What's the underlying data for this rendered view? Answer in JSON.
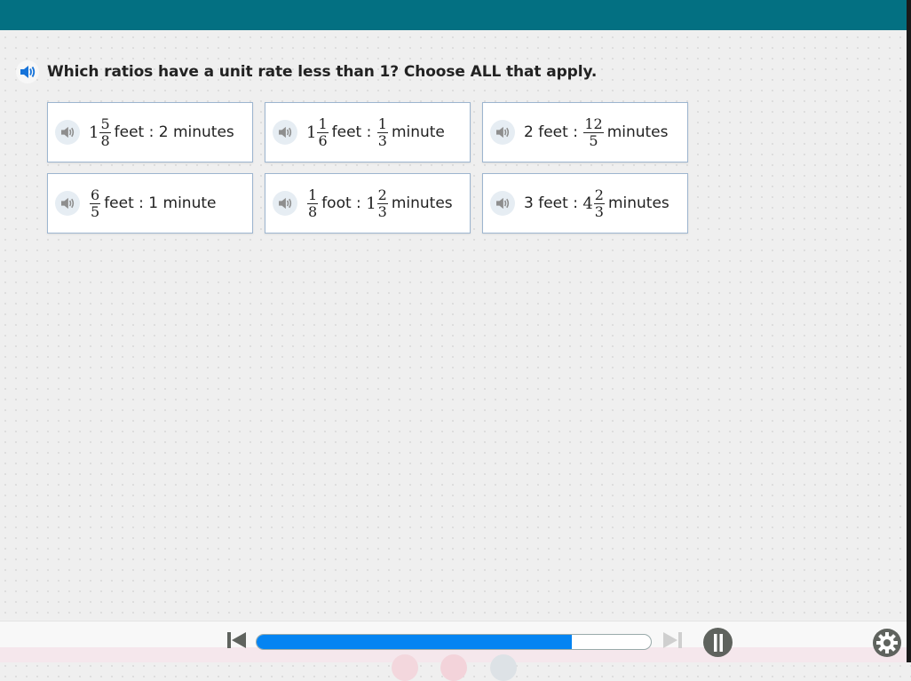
{
  "header": {
    "color": "#037082"
  },
  "question": {
    "text": "Which ratios have a unit rate less than 1? Choose ALL that apply.",
    "audio_icon": "speaker-icon"
  },
  "choices": [
    {
      "parts": [
        {
          "t": "num",
          "v": "1"
        },
        {
          "t": "frac",
          "n": "5",
          "d": "8"
        },
        {
          "t": "txt",
          "v": "feet : 2 minutes"
        }
      ]
    },
    {
      "parts": [
        {
          "t": "num",
          "v": "1"
        },
        {
          "t": "frac",
          "n": "1",
          "d": "6"
        },
        {
          "t": "txt",
          "v": "feet : "
        },
        {
          "t": "frac",
          "n": "1",
          "d": "3"
        },
        {
          "t": "txt",
          "v": "minute"
        }
      ]
    },
    {
      "parts": [
        {
          "t": "txt",
          "v": "2 feet : "
        },
        {
          "t": "frac",
          "n": "12",
          "d": "5"
        },
        {
          "t": "txt",
          "v": "minutes"
        }
      ]
    },
    {
      "parts": [
        {
          "t": "frac",
          "n": "6",
          "d": "5"
        },
        {
          "t": "txt",
          "v": "feet : 1 minute"
        }
      ]
    },
    {
      "parts": [
        {
          "t": "frac",
          "n": "1",
          "d": "8"
        },
        {
          "t": "txt",
          "v": "foot : "
        },
        {
          "t": "num",
          "v": "1"
        },
        {
          "t": "frac",
          "n": "2",
          "d": "3"
        },
        {
          "t": "txt",
          "v": "minutes"
        }
      ]
    },
    {
      "parts": [
        {
          "t": "txt",
          "v": "3 feet : "
        },
        {
          "t": "num",
          "v": "4"
        },
        {
          "t": "frac",
          "n": "2",
          "d": "3"
        },
        {
          "t": "txt",
          "v": "minutes"
        }
      ]
    }
  ],
  "player": {
    "progress_percent": 80,
    "progress_color": "#0584f2",
    "prev_icon": "skip-back-icon",
    "next_icon": "skip-forward-icon",
    "pause_icon": "pause-icon",
    "settings_icon": "gear-icon"
  }
}
